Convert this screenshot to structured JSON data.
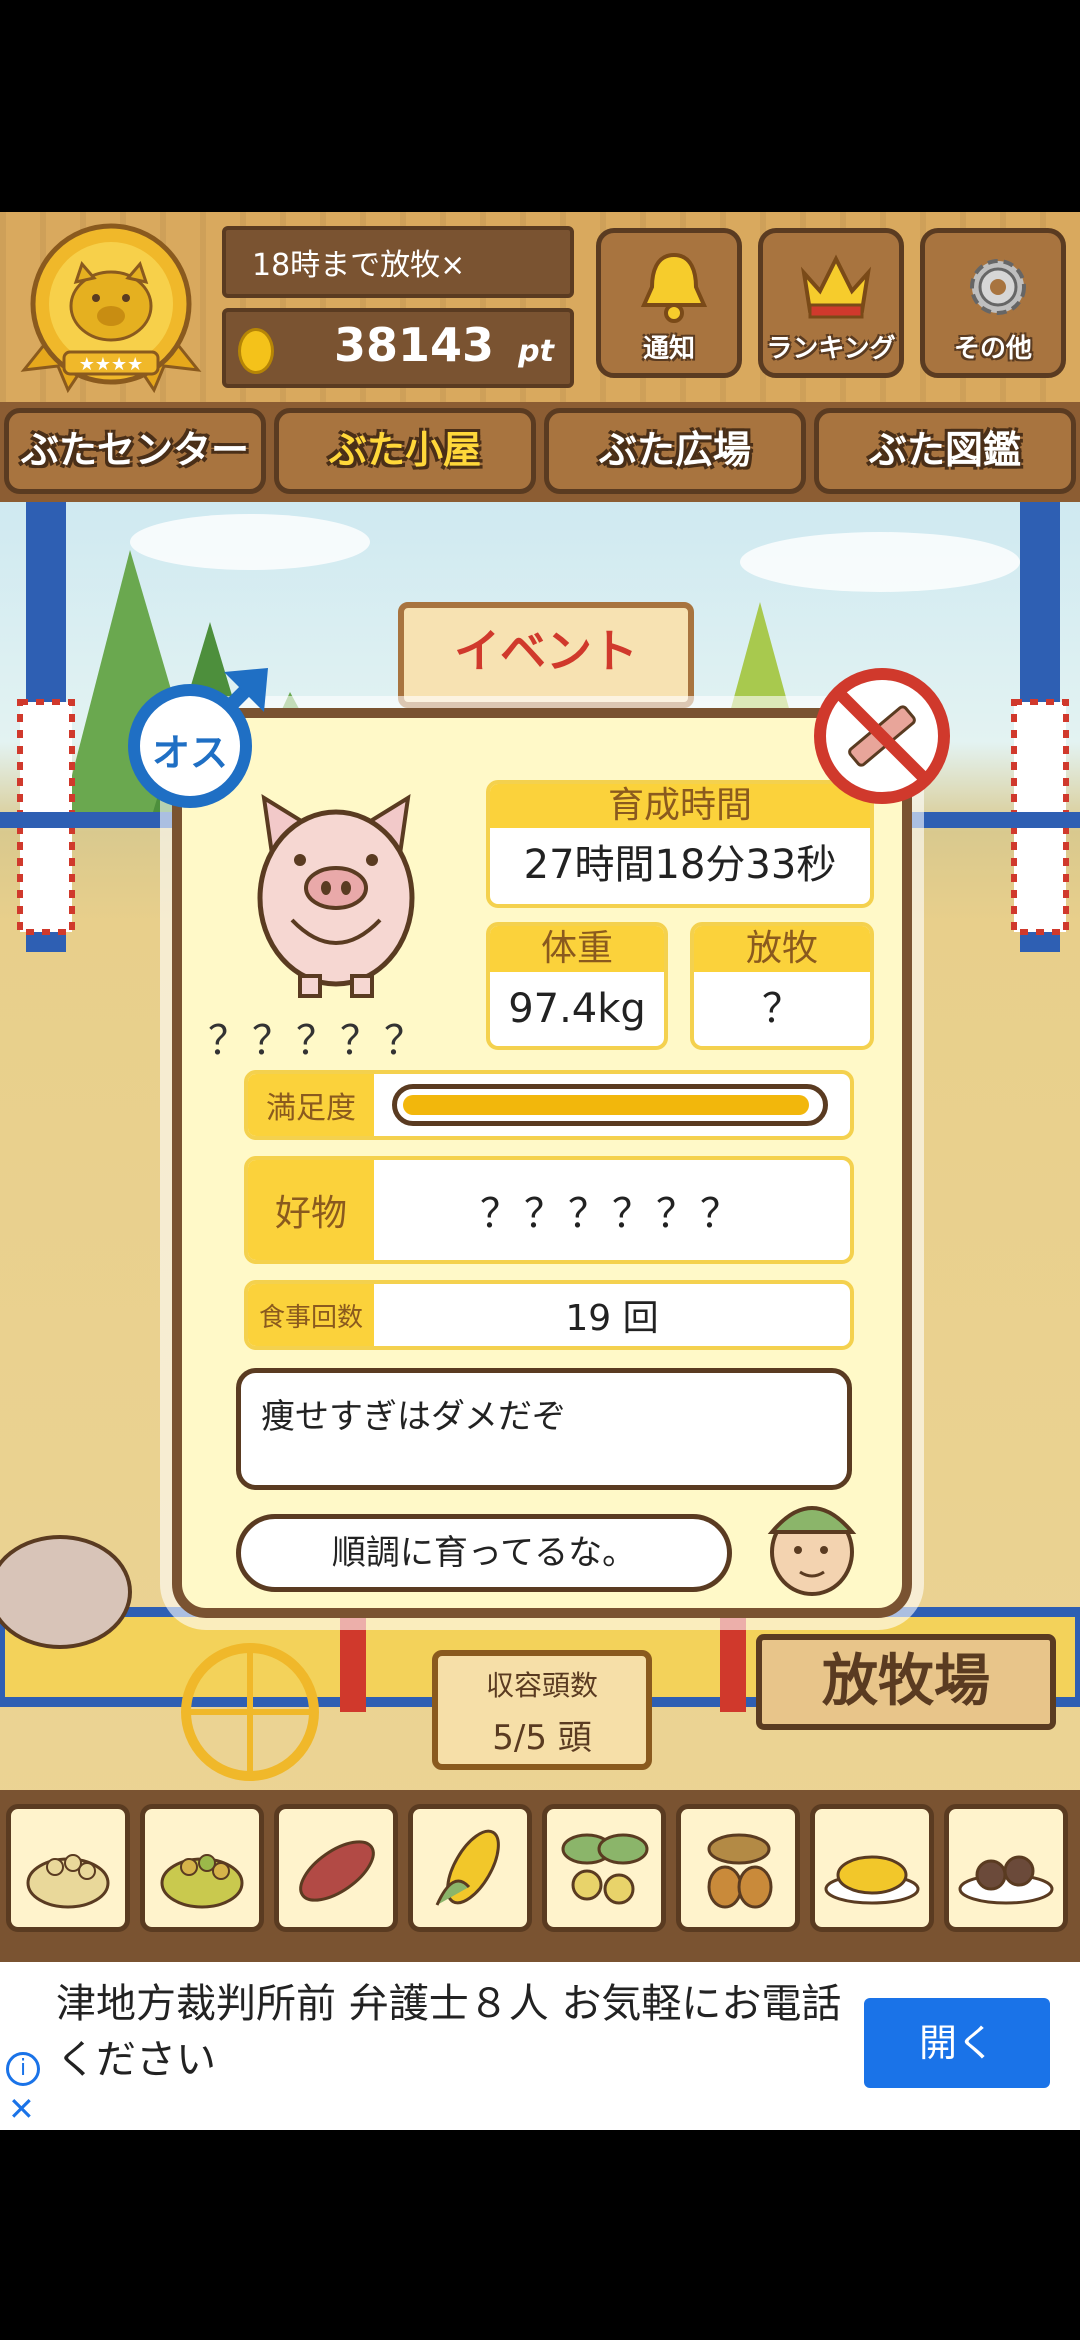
{
  "header": {
    "notice": "18時まで放牧×",
    "points_value": "38143",
    "points_unit": "pt",
    "buttons": [
      {
        "label": "通知",
        "icon": "bell-icon"
      },
      {
        "label": "ランキング",
        "icon": "crown-icon"
      },
      {
        "label": "その他",
        "icon": "gear-icon"
      }
    ]
  },
  "tabs": [
    "ぶたセンター",
    "ぶた小屋",
    "ぶた広場",
    "ぶた図鑑"
  ],
  "active_tab": 1,
  "scene": {
    "event_sign": "イベント",
    "capacity_label": "収容頭数",
    "capacity_value": "5/5 頭",
    "ranch_sign": "放牧場"
  },
  "pig": {
    "gender_badge": "オス",
    "name": "？？？？？",
    "raise_time_label": "育成時間",
    "raise_time": "27時間18分33秒",
    "weight_label": "体重",
    "weight": "97.4kg",
    "grazing_label": "放牧",
    "grazing": "？",
    "satisfaction_label": "満足度",
    "satisfaction_level": 0.98,
    "favorite_label": "好物",
    "favorite": "？？？？？？",
    "meals_label": "食事回数",
    "meals": "19 回",
    "comment1": "痩せすぎはダメだぞ",
    "comment2": "順調に育ってるな。"
  },
  "feed_slots": [
    "grain-feed-icon",
    "mixed-grain-icon",
    "sweet-potato-icon",
    "corn-icon",
    "vegetables-icon",
    "acorn-icon",
    "premium-grain-icon",
    "meatball-icon"
  ],
  "ad": {
    "text": "津地方裁判所前 弁護士８人 お気軽にお電話ください",
    "button": "開く"
  },
  "colors": {
    "wood": "#a8743f",
    "accent": "#fbd23b",
    "gender": "#1f6fc4",
    "ad_button": "#1a73e8"
  }
}
